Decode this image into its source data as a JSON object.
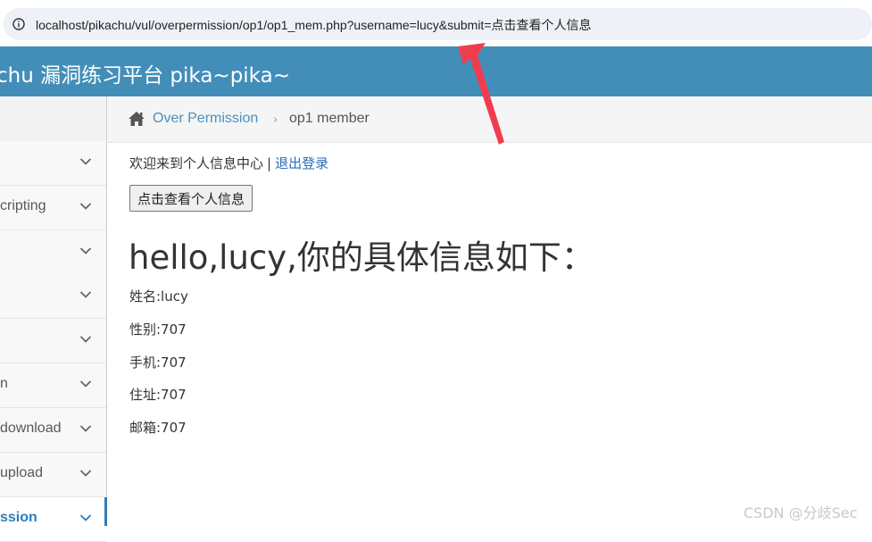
{
  "browser": {
    "url": "localhost/pikachu/vul/overpermission/op1/op1_mem.php?username=lucy&submit=点击查看个人信息"
  },
  "header": {
    "brand": "chu 漏洞练习平台 pika~pika~"
  },
  "sidebar": {
    "items": [
      {
        "label": ""
      },
      {
        "label": "cripting"
      },
      {
        "label": ""
      },
      {
        "label": ""
      },
      {
        "label": ""
      },
      {
        "label": "n"
      },
      {
        "label": "download"
      },
      {
        "label": "upload"
      },
      {
        "label": "ssion"
      }
    ]
  },
  "breadcrumb": {
    "section": "Over Permission",
    "current": "op1 member"
  },
  "main": {
    "welcome": "欢迎来到个人信息中心",
    "separator": "|",
    "logout": "退出登录",
    "view_button": "点击查看个人信息",
    "heading": "hello,lucy,你的具体信息如下：",
    "name": "姓名:lucy",
    "sex": "性别:707",
    "phone": "手机:707",
    "address": "住址:707",
    "email": "邮箱:707"
  },
  "watermark": "CSDN @分歧Sec",
  "colors": {
    "header_bg": "#438eb9",
    "link": "#4c8fbd",
    "arrow": "#f03d4d"
  }
}
